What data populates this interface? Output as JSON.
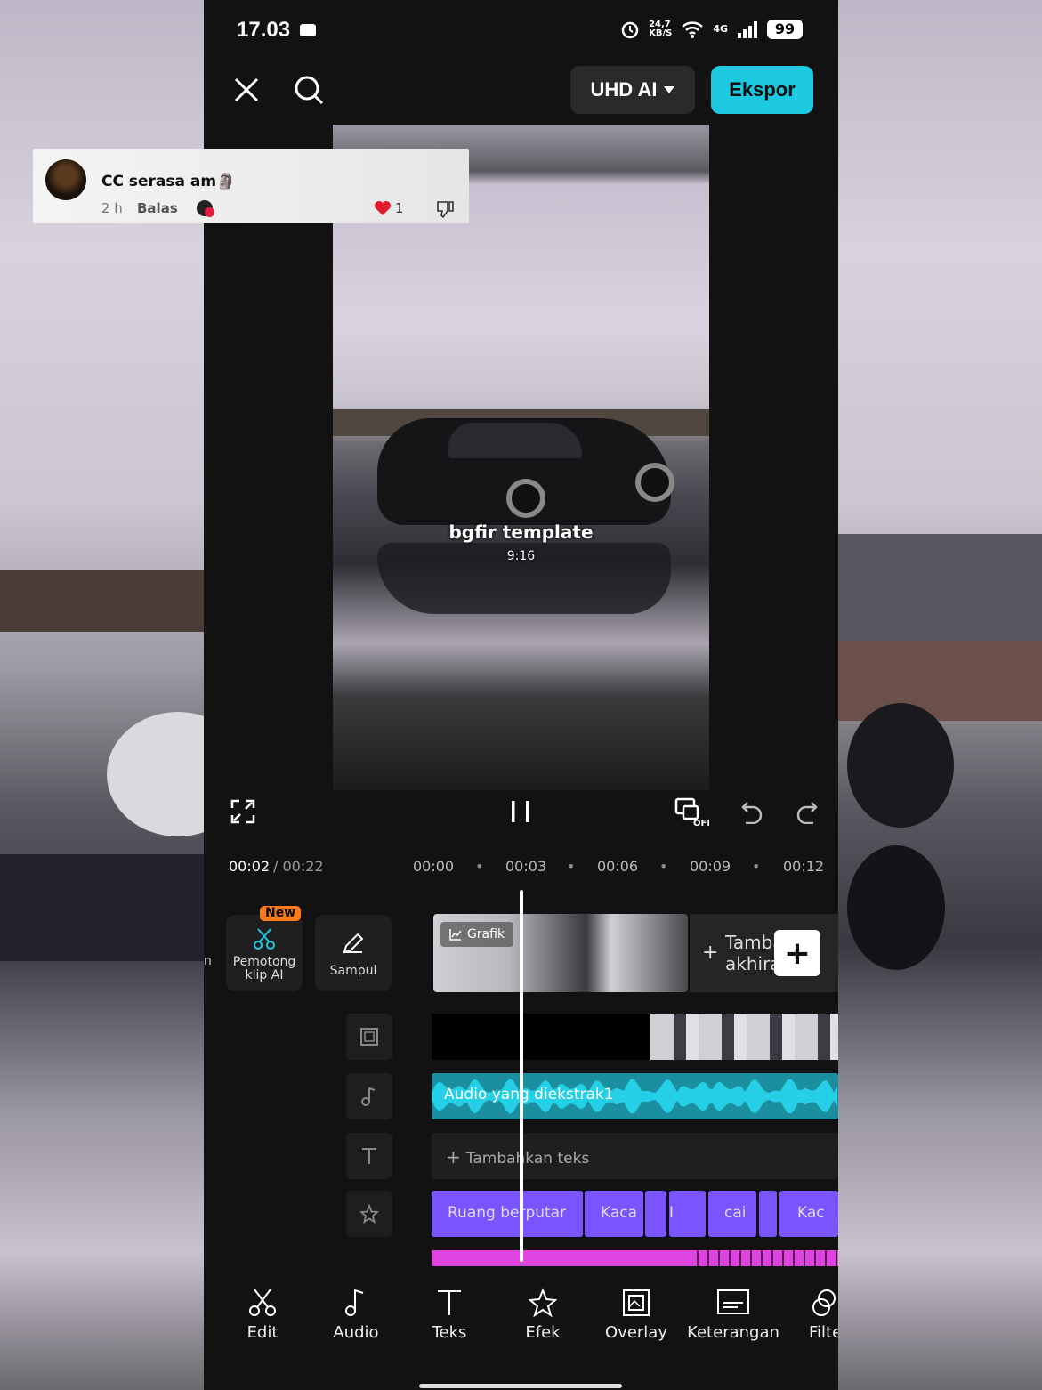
{
  "status": {
    "time": "17.03",
    "net_speed": "24,7\nKB/S",
    "net_type": "4G",
    "battery": "99"
  },
  "topbar": {
    "quality": "UHD AI",
    "export_label": "Ekspor"
  },
  "preview": {
    "title": "bgfir template",
    "ratio": "9:16"
  },
  "controls": {
    "proxy_badge": "OFF"
  },
  "timeline": {
    "current": "00:02",
    "total": "/ 00:22",
    "ticks": [
      "00:00",
      "00:03",
      "00:06",
      "00:09",
      "00:12"
    ]
  },
  "tools": {
    "ai_cut_badge": "New",
    "ai_cut_label": "Pemotong klip AI",
    "cover_label": "Sampul",
    "left_edge_char": "n"
  },
  "clips": {
    "graphic_label": "Grafik",
    "add_end_label_line1": "Tamba",
    "add_end_label_line2": "akhira",
    "audio_label": "Audio yang diekstrak1",
    "add_text_label": "Tambahkan teks",
    "effects": [
      "Ruang berputar",
      "Kaca",
      "I",
      "cai",
      "Kac"
    ]
  },
  "bottom_nav": [
    {
      "label": "Edit",
      "icon": "scissors-icon"
    },
    {
      "label": "Audio",
      "icon": "music-note-icon"
    },
    {
      "label": "Teks",
      "icon": "text-icon"
    },
    {
      "label": "Efek",
      "icon": "star-effect-icon"
    },
    {
      "label": "Overlay",
      "icon": "overlay-icon"
    },
    {
      "label": "Keterangan",
      "icon": "caption-icon"
    },
    {
      "label": "Filte",
      "icon": "filter-icon"
    }
  ],
  "comment": {
    "text": "CC serasa am🗿",
    "age": "2 h",
    "reply": "Balas",
    "likes": "1"
  },
  "colors": {
    "accent": "#1cc9e0",
    "audio": "#1b8fa0",
    "effect": "#7a55ff",
    "badge": "#ff7a1a"
  }
}
